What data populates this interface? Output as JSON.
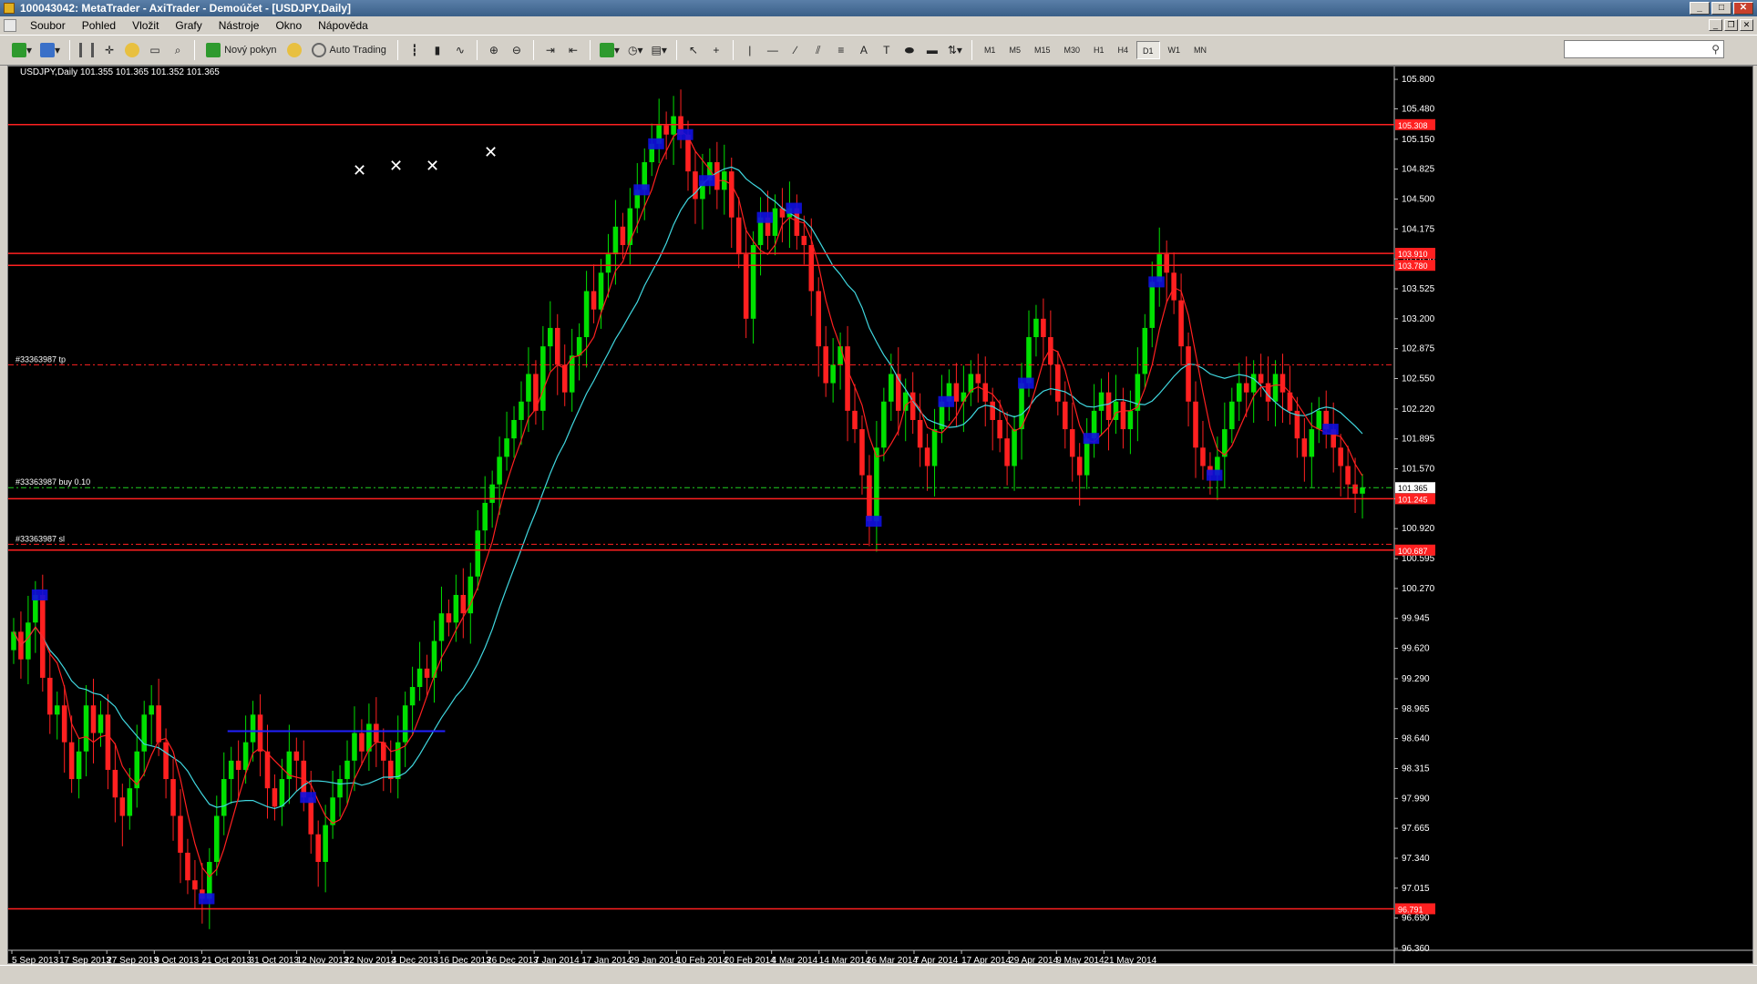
{
  "window": {
    "title": "100043042: MetaTrader - AxiTrader - Demoúčet - [USDJPY,Daily]",
    "minimize": "_",
    "maximize": "□",
    "close": "✕"
  },
  "menu": {
    "items": [
      "Soubor",
      "Pohled",
      "Vložit",
      "Grafy",
      "Nástroje",
      "Okno",
      "Nápověda"
    ],
    "mdi_minimize": "_",
    "mdi_restore": "❐",
    "mdi_close": "✕"
  },
  "toolbar": {
    "new_order_label": "Nový pokyn",
    "auto_trading_label": "Auto Trading",
    "timeframes": [
      "M1",
      "M5",
      "M15",
      "M30",
      "H1",
      "H4",
      "D1",
      "W1",
      "MN"
    ],
    "active_timeframe": "D1",
    "search_placeholder": ""
  },
  "chart": {
    "symbol_line": "USDJPY,Daily  101.355 101.365 101.352 101.365",
    "bg_color": "#000000",
    "bull_color": "#00e000",
    "bear_color": "#ff2020",
    "ma_fast_color": "#ff2020",
    "ma_slow_color": "#40d8e0",
    "hline_color": "#ff2020",
    "zone_color": "#1010e0",
    "order_labels": {
      "tp": "#33363987 tp",
      "buy": "#33363987 buy 0.10",
      "sl": "#33363987 sl"
    },
    "markers": [
      "✕",
      "✕",
      "✕",
      "✕"
    ]
  },
  "chart_data": {
    "type": "candlestick",
    "symbol": "USDJPY",
    "timeframe": "Daily",
    "ylim": [
      96.36,
      105.88
    ],
    "y_ticks": [
      "105.800",
      "105.480",
      "105.150",
      "104.825",
      "104.500",
      "104.175",
      "103.850",
      "103.525",
      "103.200",
      "102.875",
      "102.550",
      "102.220",
      "101.895",
      "101.570",
      "101.245",
      "100.920",
      "100.595",
      "100.270",
      "99.945",
      "99.620",
      "99.290",
      "98.965",
      "98.640",
      "98.315",
      "97.990",
      "97.665",
      "97.340",
      "97.015",
      "96.690",
      "96.360"
    ],
    "x_ticks": [
      "5 Sep 2013",
      "17 Sep 2013",
      "27 Sep 2013",
      "9 Oct 2013",
      "21 Oct 2013",
      "31 Oct 2013",
      "12 Nov 2013",
      "22 Nov 2013",
      "4 Dec 2013",
      "16 Dec 2013",
      "26 Dec 2013",
      "7 Jan 2014",
      "17 Jan 2014",
      "29 Jan 2014",
      "10 Feb 2014",
      "20 Feb 2014",
      "4 Mar 2014",
      "14 Mar 2014",
      "26 Mar 2014",
      "7 Apr 2014",
      "17 Apr 2014",
      "29 Apr 2014",
      "9 May 2014",
      "21 May 2014"
    ],
    "horizontal_lines": [
      {
        "price": 105.308,
        "label": "105.308",
        "style": "solid"
      },
      {
        "price": 103.91,
        "label": "103.910",
        "style": "solid"
      },
      {
        "price": 103.78,
        "label": "103.780",
        "style": "solid"
      },
      {
        "price": 101.245,
        "label": "101.245",
        "style": "solid"
      },
      {
        "price": 100.687,
        "label": "100.687",
        "style": "solid"
      },
      {
        "price": 96.791,
        "label": "96.791",
        "style": "solid"
      }
    ],
    "order_lines": [
      {
        "name": "tp",
        "price": 102.7
      },
      {
        "name": "buy",
        "price": 101.365
      },
      {
        "name": "sl",
        "price": 100.75
      }
    ],
    "current_price": "101.365",
    "candles_close": [
      99.8,
      99.5,
      99.9,
      100.2,
      99.3,
      98.9,
      99.0,
      98.6,
      98.2,
      98.5,
      99.0,
      98.7,
      98.9,
      98.3,
      98.0,
      97.8,
      98.1,
      98.5,
      98.9,
      99.0,
      98.6,
      98.2,
      97.8,
      97.4,
      97.1,
      97.0,
      96.9,
      97.3,
      97.8,
      98.2,
      98.4,
      98.3,
      98.6,
      98.9,
      98.5,
      98.1,
      97.9,
      98.2,
      98.5,
      98.4,
      98.0,
      97.6,
      97.3,
      97.7,
      98.0,
      98.2,
      98.4,
      98.7,
      98.5,
      98.8,
      98.6,
      98.4,
      98.2,
      98.6,
      99.0,
      99.2,
      99.4,
      99.3,
      99.7,
      100.0,
      99.9,
      100.2,
      100.0,
      100.4,
      100.9,
      101.2,
      101.4,
      101.7,
      101.9,
      102.1,
      102.3,
      102.6,
      102.2,
      102.9,
      103.1,
      102.7,
      102.4,
      102.8,
      103.0,
      103.5,
      103.3,
      103.7,
      103.9,
      104.2,
      104.0,
      104.4,
      104.6,
      104.9,
      105.1,
      105.3,
      105.2,
      105.4,
      105.2,
      104.8,
      104.5,
      104.7,
      104.9,
      104.6,
      104.8,
      104.3,
      103.9,
      103.2,
      104.0,
      104.3,
      104.1,
      104.4,
      104.3,
      104.4,
      104.1,
      104.0,
      103.5,
      102.9,
      102.5,
      102.7,
      102.9,
      102.2,
      102.0,
      101.5,
      101.0,
      101.8,
      102.3,
      102.6,
      102.2,
      102.4,
      102.1,
      101.8,
      101.6,
      102.0,
      102.3,
      102.5,
      102.3,
      102.4,
      102.6,
      102.5,
      102.3,
      102.1,
      101.9,
      101.6,
      102.0,
      102.5,
      103.0,
      103.2,
      103.0,
      102.7,
      102.3,
      102.0,
      101.7,
      101.5,
      101.9,
      102.2,
      102.4,
      102.1,
      102.3,
      102.0,
      102.2,
      102.6,
      103.1,
      103.6,
      103.9,
      103.7,
      103.4,
      102.9,
      102.3,
      101.8,
      101.6,
      101.5,
      101.7,
      102.0,
      102.3,
      102.5,
      102.4,
      102.6,
      102.5,
      102.3,
      102.6,
      102.4,
      102.2,
      101.9,
      101.7,
      102.0,
      102.2,
      102.0,
      101.8,
      101.6,
      101.4,
      101.3,
      101.365
    ]
  }
}
